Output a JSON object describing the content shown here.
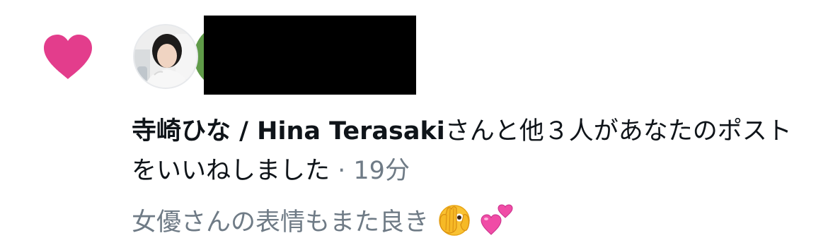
{
  "notification": {
    "type_icon": "heart-icon",
    "accent_color": "#e33d8c",
    "avatars": [
      {
        "name": "寺崎ひな / Hina Terasaki",
        "redacted": false
      },
      {
        "name": "",
        "redacted": true
      }
    ],
    "message": {
      "user_name": "寺崎ひな / Hina Terasaki",
      "action_text": "さんと他３人があなたのポストをいいねしました",
      "separator": " · ",
      "time_ago": "19分"
    },
    "post_preview": {
      "text": "女優さんの表情もまた良き",
      "emojis": [
        "face-with-peeking-eye",
        "two-hearts"
      ]
    }
  }
}
